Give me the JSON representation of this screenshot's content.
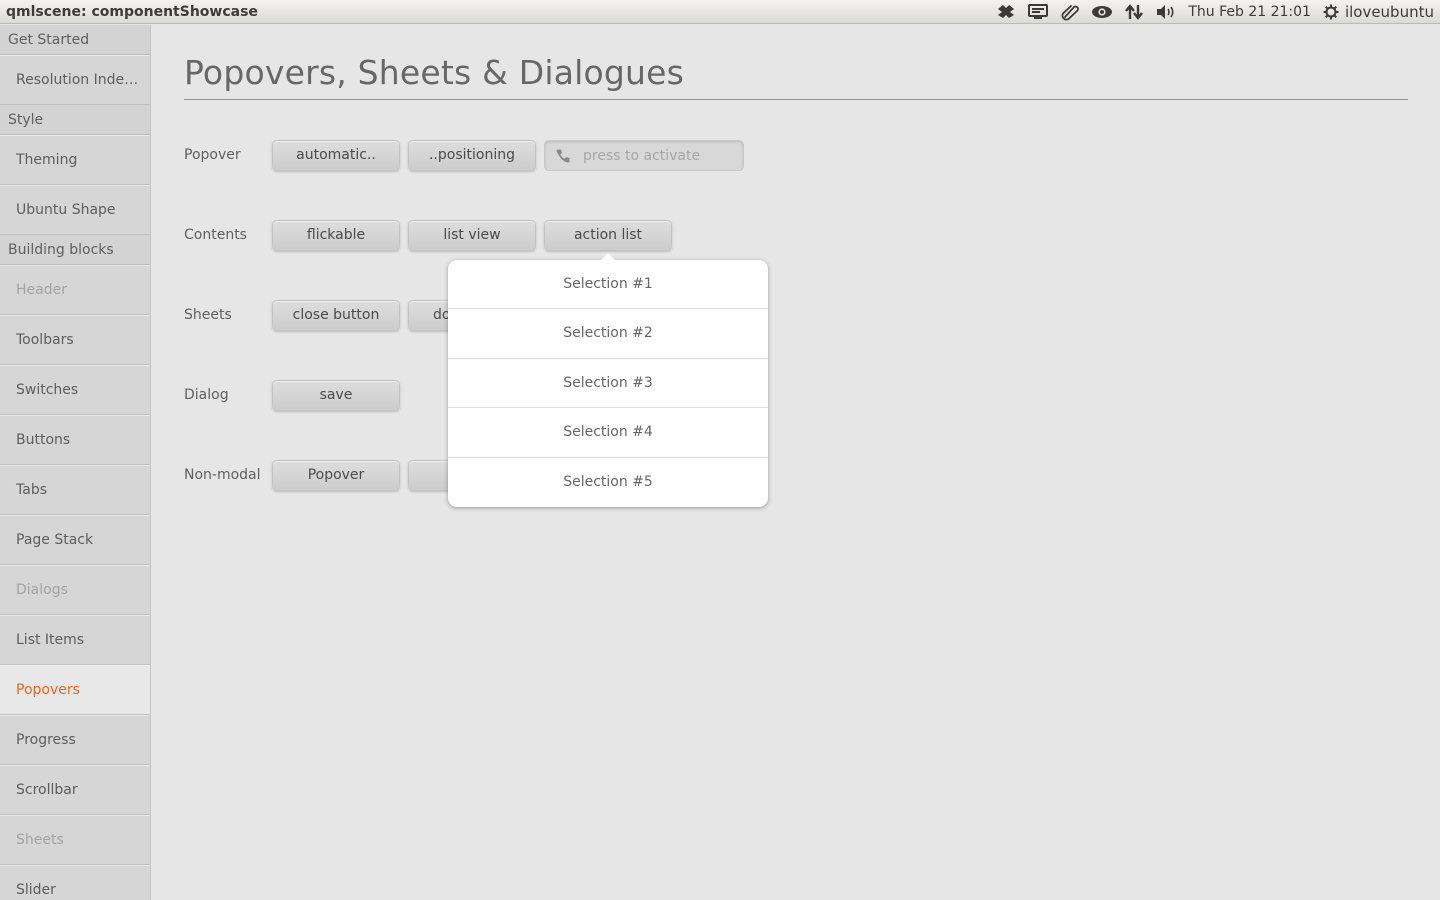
{
  "window": {
    "title": "qmlscene: componentShowcase"
  },
  "tray": {
    "icons": [
      "dropbox-icon",
      "display-icon",
      "paperclip-icon",
      "eye-icon",
      "network-transfer-icon",
      "volume-icon"
    ],
    "clock": "Thu Feb 21  21:01",
    "user": "iloveubuntu"
  },
  "sidebar": {
    "sections": [
      {
        "header": "Get Started",
        "items": [
          {
            "label": "Resolution Inde…",
            "state": "normal"
          }
        ]
      },
      {
        "header": "Style",
        "items": [
          {
            "label": "Theming",
            "state": "normal"
          },
          {
            "label": "Ubuntu Shape",
            "state": "normal"
          }
        ]
      },
      {
        "header": "Building blocks",
        "items": [
          {
            "label": "Header",
            "state": "disabled"
          },
          {
            "label": "Toolbars",
            "state": "normal"
          },
          {
            "label": "Switches",
            "state": "normal"
          },
          {
            "label": "Buttons",
            "state": "normal"
          },
          {
            "label": "Tabs",
            "state": "normal"
          },
          {
            "label": "Page Stack",
            "state": "normal"
          },
          {
            "label": "Dialogs",
            "state": "disabled"
          },
          {
            "label": "List Items",
            "state": "normal"
          },
          {
            "label": "Popovers",
            "state": "selected"
          },
          {
            "label": "Progress",
            "state": "normal"
          },
          {
            "label": "Scrollbar",
            "state": "normal"
          },
          {
            "label": "Sheets",
            "state": "disabled"
          },
          {
            "label": "Slider",
            "state": "normal"
          }
        ]
      }
    ]
  },
  "main": {
    "title": "Popovers, Sheets & Dialogues",
    "rows": {
      "popover": {
        "label": "Popover",
        "buttons": [
          "automatic..",
          "..positioning"
        ],
        "field_placeholder": "press to activate"
      },
      "contents": {
        "label": "Contents",
        "buttons": [
          "flickable",
          "list view",
          "action list"
        ]
      },
      "sheets": {
        "label": "Sheets",
        "buttons": [
          "close button",
          "do"
        ]
      },
      "dialog": {
        "label": "Dialog",
        "buttons": [
          "save"
        ]
      },
      "nonmodal": {
        "label": "Non-modal",
        "buttons": [
          "Popover",
          ""
        ]
      }
    }
  },
  "popover": {
    "items": [
      "Selection #1",
      "Selection #2",
      "Selection #3",
      "Selection #4",
      "Selection #5"
    ]
  },
  "colors": {
    "accent": "#e66a17",
    "background": "#e6e6e6"
  }
}
